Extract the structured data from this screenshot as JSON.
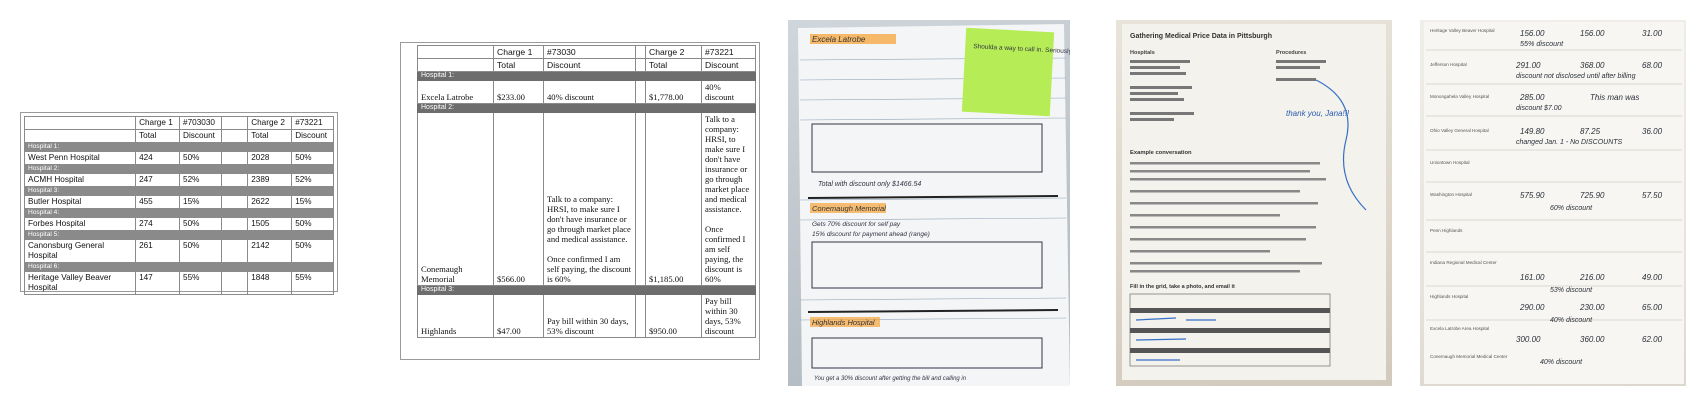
{
  "table1": {
    "header_row1": [
      "",
      "Charge 1",
      "#703030",
      "",
      "Charge 2",
      "#73221"
    ],
    "header_row2": [
      "",
      "Total",
      "Discount",
      "",
      "Total",
      "Discount"
    ],
    "sections": [
      {
        "label": "Hospital 1:",
        "name": "West Penn Hospital",
        "t1": "424",
        "d1": "50%",
        "t2": "2028",
        "d2": "50%"
      },
      {
        "label": "Hospital 2:",
        "name": "ACMH Hospital",
        "t1": "247",
        "d1": "52%",
        "t2": "2389",
        "d2": "52%"
      },
      {
        "label": "Hospital 3:",
        "name": "Butler Hospital",
        "t1": "455",
        "d1": "15%",
        "t2": "2622",
        "d2": "15%"
      },
      {
        "label": "Hospital 4:",
        "name": "Forbes Hospital",
        "t1": "274",
        "d1": "50%",
        "t2": "1505",
        "d2": "50%"
      },
      {
        "label": "Hospital 5:",
        "name": "Canonsburg General Hospital",
        "t1": "261",
        "d1": "50%",
        "t2": "2142",
        "d2": "50%"
      },
      {
        "label": "Hospital 6:",
        "name": "Heritage Valley Beaver Hospital",
        "t1": "147",
        "d1": "55%",
        "t2": "1848",
        "d2": "55%"
      }
    ]
  },
  "table2": {
    "header_row1": [
      "",
      "Charge 1",
      "#73030",
      "",
      "Charge 2",
      "#73221"
    ],
    "header_row2": [
      "",
      "Total",
      "Discount",
      "",
      "Total",
      "Discount"
    ],
    "sections": [
      {
        "label": "Hospital 1:",
        "name": "Excela Latrobe",
        "t1": "$233.00",
        "d1": "40% discount",
        "t2": "$1,778.00",
        "d2": "40% discount"
      },
      {
        "label": "Hospital 2:",
        "name": "Conemaugh Memorial",
        "t1": "$566.00",
        "d1": "Talk to a company: HRSI, to make sure I don't have insurance or go through market place and medical assistance.\n\nOnce confirmed I am self paying, the discount is 60%",
        "t2": "$1,185.00",
        "d2": "Talk to a company: HRSI, to make sure I don't have insurance or go through market place and medical assistance.\n\nOnce confirmed I am self paying, the discount is 60%"
      },
      {
        "label": "Hospital 3:",
        "name": "Highlands",
        "t1": "$47.00",
        "d1": "Pay bill within 30 days, 53% discount",
        "t2": "$950.00",
        "d2": "Pay bill within 30 days, 53% discount"
      }
    ]
  },
  "photo1": {
    "hospital1": "Excela Latrobe",
    "total_discount_line": "Total with discount only $1466.54",
    "hospital2": "Conemaugh Memorial",
    "discount_note1": "Gets 70% discount for self pay",
    "discount_note2": "15% discount for payment ahead (range)",
    "hospital3": "Highlands Hospital",
    "footer_note": "You get a 30% discount after getting the bill and calling in",
    "sticky_note": "Shoulda a way to call in. Seriously."
  },
  "photo2": {
    "title": "Gathering Medical Price Data in Pittsburgh",
    "col_hospitals": "Hospitals",
    "col_procedures": "Procedures",
    "example": "Example conversation",
    "thanks": "thank you, Jana!!!",
    "fill_grid": "Fill in the grid, take a photo, and email it"
  },
  "photo3": {
    "hospitals": [
      "Heritage Valley Beaver Hospital",
      "Jefferson Hospital",
      "Monongahela Valley Hospital",
      "Ohio Valley General Hospital",
      "Uniontown Hospital",
      "Washington Hospital",
      "Penn Highlands",
      "Indiana Regional Medical Center",
      "Highlands Hospital",
      "Excela Latrobe Area Hospital",
      "Conemaugh Memorial Medical Center"
    ],
    "values_row1": [
      "156.00",
      "156.00",
      "31.00"
    ],
    "note1": "55% discount",
    "values_row2": [
      "291.00",
      "368.00",
      "68.00"
    ],
    "note2": "discount not disclosed until after billing",
    "values_row3": [
      "285.00",
      "This man was"
    ],
    "note3": "discount $7.00",
    "values_row4": [
      "149.80",
      "87.25",
      "36.00"
    ],
    "note4": "changed Jan. 1 - No DISCOUNTS",
    "values_row5": [
      "575.90",
      "725.90",
      "57.50"
    ],
    "note5": "60% discount",
    "values_row6": [
      "161.00",
      "216.00",
      "49.00"
    ],
    "note6": "53% discount",
    "values_row7": [
      "290.00",
      "230.00",
      "65.00"
    ],
    "note7": "40% discount",
    "values_row8": [
      "300.00",
      "360.00",
      "62.00"
    ],
    "note8": "40% discount"
  }
}
